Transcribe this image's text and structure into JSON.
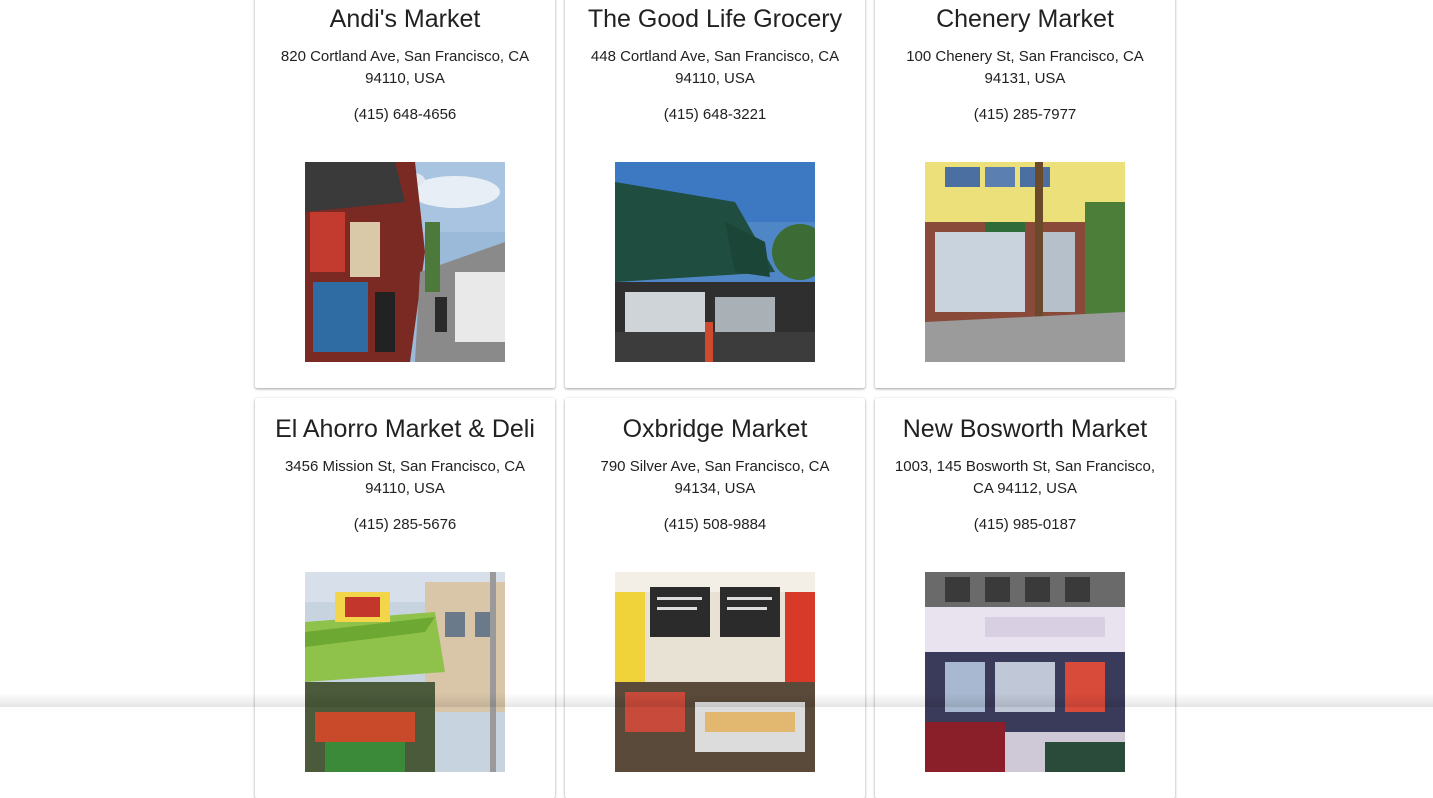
{
  "stores": [
    {
      "name": "Andi's Market",
      "address": "820 Cortland Ave, San Francisco, CA 94110, USA",
      "phone": "(415) 648-4656",
      "photo": "storefront-photo"
    },
    {
      "name": "The Good Life Grocery",
      "address": "448 Cortland Ave, San Francisco, CA 94110, USA",
      "phone": "(415) 648-3221",
      "photo": "storefront-photo"
    },
    {
      "name": "Chenery Market",
      "address": "100 Chenery St, San Francisco, CA 94131, USA",
      "phone": "(415) 285-7977",
      "photo": "storefront-photo"
    },
    {
      "name": "El Ahorro Market & Deli",
      "address": "3456 Mission St, San Francisco, CA 94110, USA",
      "phone": "(415) 285-5676",
      "photo": "storefront-photo"
    },
    {
      "name": "Oxbridge Market",
      "address": "790 Silver Ave, San Francisco, CA 94134, USA",
      "phone": "(415) 508-9884",
      "photo": "interior-photo"
    },
    {
      "name": "New Bosworth Market",
      "address": "1003, 145 Bosworth St, San Francisco, CA 94112, USA",
      "phone": "(415) 985-0187",
      "photo": "storefront-photo"
    }
  ]
}
